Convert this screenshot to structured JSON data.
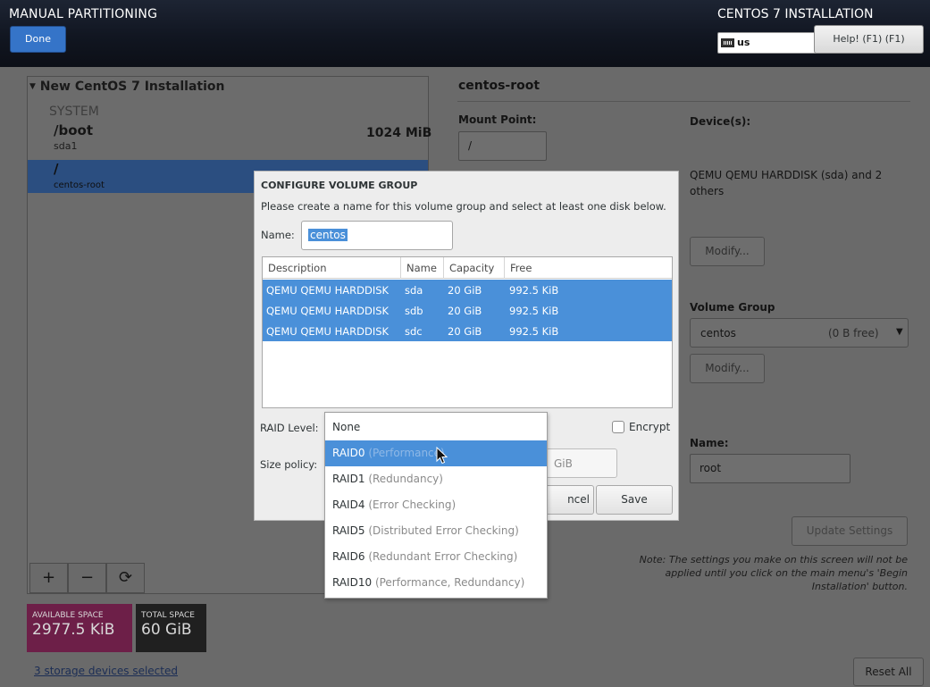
{
  "header": {
    "title": "MANUAL PARTITIONING",
    "done_label": "Done",
    "product": "CENTOS 7 INSTALLATION",
    "keyboard_layout": "us",
    "help_label": "Help! (F1) (F1)"
  },
  "left_panel": {
    "section_title": "New CentOS 7 Installation",
    "group": "SYSTEM",
    "mounts": [
      {
        "mount": "/boot",
        "device": "sda1",
        "size": "1024 MiB",
        "selected": false
      },
      {
        "mount": "/",
        "device": "centos-root",
        "size": "",
        "selected": true
      }
    ],
    "toolbar": {
      "add": "+",
      "remove": "−",
      "refresh": "⟳"
    },
    "available_space": {
      "label": "AVAILABLE SPACE",
      "value": "2977.5 KiB",
      "color": "#6d1f48"
    },
    "total_space": {
      "label": "TOTAL SPACE",
      "value": "60 GiB",
      "color": "#202020"
    },
    "storage_link": "3 storage devices selected"
  },
  "right_panel": {
    "title": "centos-root",
    "mount_point_label": "Mount Point:",
    "mount_point_value": "/",
    "devices_label": "Device(s):",
    "devices_value": "QEMU QEMU HARDDISK (sda) and 2 others",
    "modify_label": "Modify...",
    "volume_group_label": "Volume Group",
    "volume_group_value": "centos",
    "volume_group_free": "(0 B free)",
    "modify2_label": "Modify...",
    "name_label": "Name:",
    "name_value": "root",
    "update_label": "Update Settings",
    "note": "Note:  The settings you make on this screen will not be applied until you click on the main menu's 'Begin Installation' button.",
    "reset_label": "Reset All"
  },
  "dialog": {
    "title": "CONFIGURE VOLUME GROUP",
    "description": "Please create a name for this volume group and select at least one disk below.",
    "name_label": "Name:",
    "name_value": "centos",
    "table": {
      "headers": [
        "Description",
        "Name",
        "Capacity",
        "Free"
      ],
      "rows": [
        [
          "QEMU QEMU HARDDISK",
          "sda",
          "20 GiB",
          "992.5 KiB"
        ],
        [
          "QEMU QEMU HARDDISK",
          "sdb",
          "20 GiB",
          "992.5 KiB"
        ],
        [
          "QEMU QEMU HARDDISK",
          "sdc",
          "20 GiB",
          "992.5 KiB"
        ]
      ]
    },
    "raid_label": "RAID Level:",
    "encrypt_label": "Encrypt",
    "size_policy_label": "Size policy:",
    "size_value": "GiB",
    "cancel_label": "ncel",
    "save_label": "Save"
  },
  "raid_dropdown": {
    "items": [
      {
        "name": "None",
        "desc": ""
      },
      {
        "name": "RAID0",
        "desc": "(Performance)"
      },
      {
        "name": "RAID1",
        "desc": "(Redundancy)"
      },
      {
        "name": "RAID4",
        "desc": "(Error Checking)"
      },
      {
        "name": "RAID5",
        "desc": "(Distributed Error Checking)"
      },
      {
        "name": "RAID6",
        "desc": "(Redundant Error Checking)"
      },
      {
        "name": "RAID10",
        "desc": "(Performance, Redundancy)"
      }
    ]
  },
  "colors": {
    "accent": "#4a90d9",
    "done_button": "#3574c8",
    "header_bg": "#111621"
  }
}
